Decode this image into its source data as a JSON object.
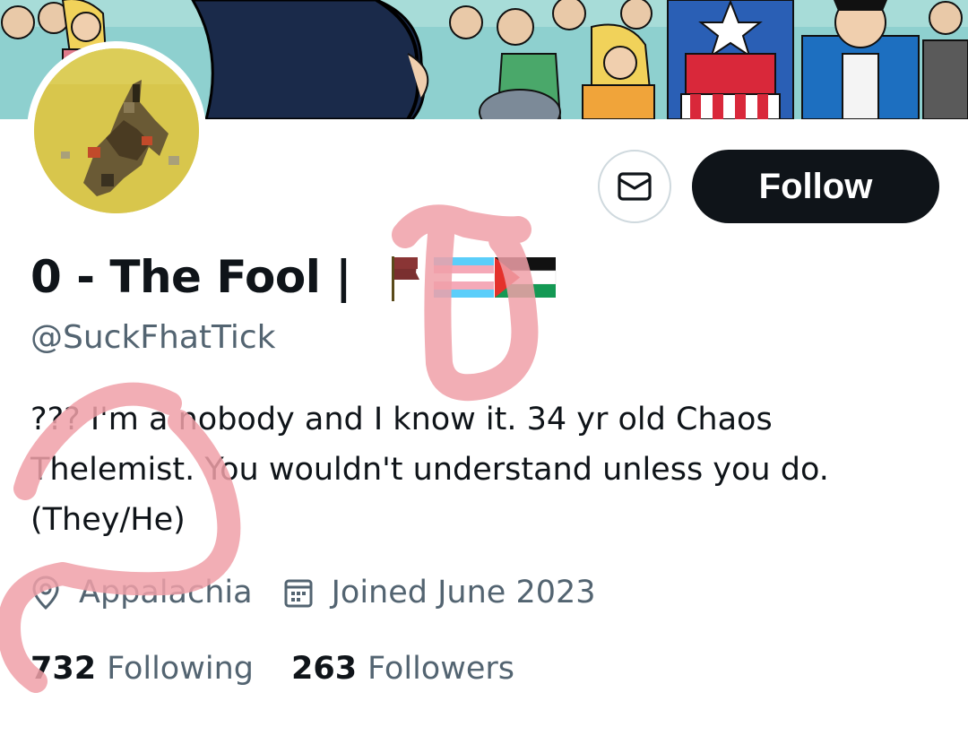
{
  "profile": {
    "display_name": "0 - The Fool |",
    "handle": "@SuckFhatTick",
    "bio_lines": [
      "??? I'm a nobody and I know it. 34 yr old Chaos",
      "Thelemist.  You wouldn't understand unless you do.",
      "(They/He)"
    ],
    "location": "Appalachia",
    "joined": "Joined June 2023",
    "following_count": "732",
    "following_label": "Following",
    "followers_count": "263",
    "followers_label": "Followers"
  },
  "actions": {
    "follow_label": "Follow",
    "message_icon": "envelope-icon"
  },
  "flags": [
    "red-black-flag",
    "transgender-flag",
    "palestine-flag"
  ],
  "icons": {
    "location": "location-pin-icon",
    "joined": "calendar-icon"
  },
  "colors": {
    "text_primary": "#0f1419",
    "text_secondary": "#536471",
    "button_dark": "#0f1419",
    "annotation_pink": "#f0a0a8"
  }
}
